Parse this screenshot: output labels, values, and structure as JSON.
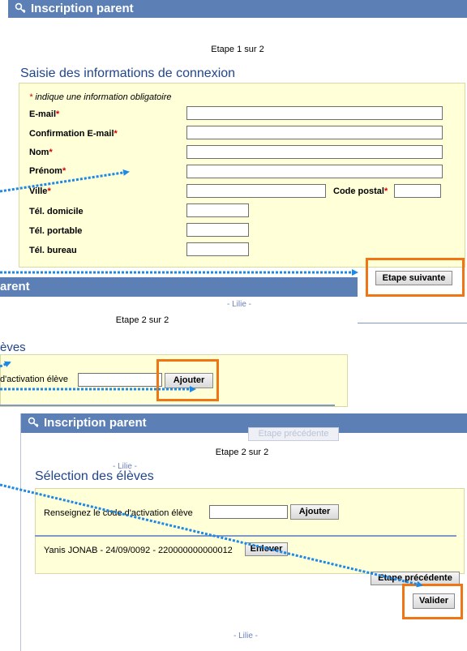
{
  "colors": {
    "title_bar": "#5c7fb6",
    "section_title": "#22468c",
    "form_bg": "#ffffd8",
    "highlight": "#f07614",
    "arrow": "#1e88e5",
    "required": "#d40000"
  },
  "screen1": {
    "title": "Inscription parent",
    "step": "Etape 1 sur 2",
    "section_title": "Saisie des informations de connexion",
    "required_note_star": "*",
    "required_note": " indique une information obligatoire",
    "fields": {
      "email": "E-mail",
      "email_confirm": "Confirmation E-mail",
      "nom": "Nom",
      "prenom": "Prénom",
      "ville": "Ville",
      "code_postal": "Code postal",
      "tel_domicile": "Tél. domicile",
      "tel_portable": "Tél. portable",
      "tel_bureau": "Tél. bureau"
    },
    "star": "*",
    "next_button": "Etape suivante",
    "footer": "- Lilie -"
  },
  "screen2": {
    "title_partial": "arent",
    "step": "Etape 2 sur 2",
    "section_partial": "èves",
    "activation_partial": "d'activation élève",
    "add_button": "Ajouter",
    "prev_button": "Etape précédente",
    "footer": "- Lilie -"
  },
  "screen3": {
    "title": "Inscription parent",
    "step": "Etape 2 sur 2",
    "section_title": "Sélection des élèves",
    "activation_label": "Renseignez le code d'activation élève",
    "add_button": "Ajouter",
    "student_entry": "Yanis JONAB - 24/09/0092 - 220000000000012",
    "remove_button": "Enlever",
    "prev_button": "Etape précédente",
    "validate_button": "Valider",
    "footer": "- Lilie -"
  }
}
